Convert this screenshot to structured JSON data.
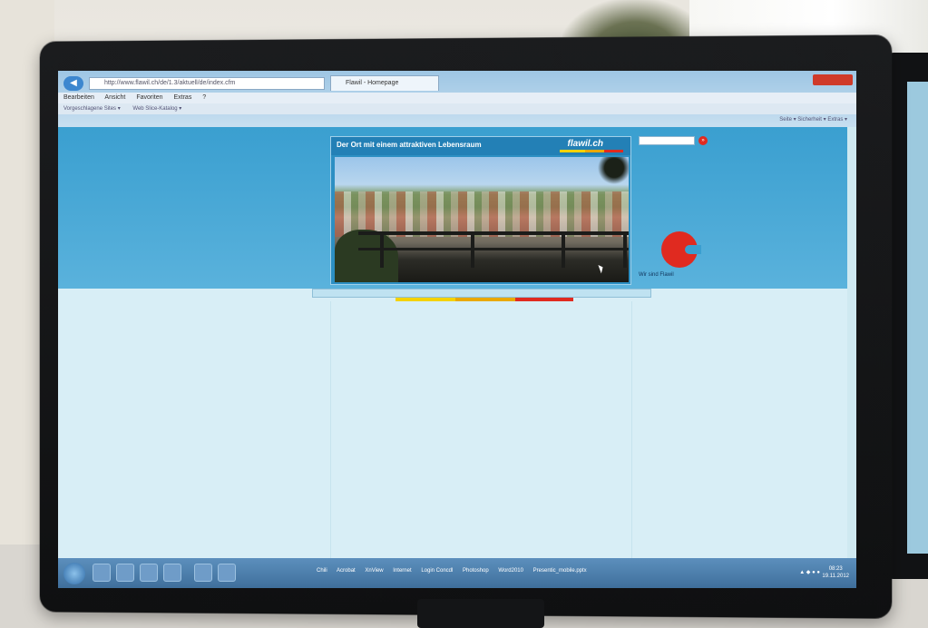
{
  "browser": {
    "address": "http://www.flawil.ch/de/1.3/aktuell/de/index.cfm",
    "tab_title": "Flawil - Homepage",
    "menu": [
      "Bearbeiten",
      "Ansicht",
      "Favoriten",
      "Extras",
      "?"
    ],
    "favorites": [
      "Vorgeschlagene Sites ▾",
      "Web Slice-Katalog ▾"
    ],
    "command_bar": "Seite ▾  Sicherheit ▾  Extras ▾"
  },
  "site": {
    "title": "Der Ort mit einem attraktiven Lebensraum",
    "logo": "flawil.ch",
    "emblem_label": "Wir sind Flawil",
    "search_go": "»"
  },
  "taskbar": {
    "items": [
      "Chili",
      "Acrobat",
      "XnView",
      "Internet",
      "Login Concdl",
      "Photoshop",
      "Word2010",
      "Presentic_mobile.pptx"
    ],
    "clock": "08:23",
    "date": "19.11.2012"
  },
  "colors": {
    "header_blue": "#3a9fd0",
    "accent_red": "#e02a20",
    "accent_yellow": "#f4d200"
  }
}
